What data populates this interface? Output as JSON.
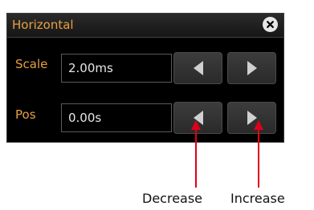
{
  "dialog": {
    "title": "Horizontal",
    "close_icon": "close-icon"
  },
  "rows": [
    {
      "label": "Scale",
      "value": "2.00ms"
    },
    {
      "label": "Pos",
      "value": "0.00s"
    }
  ],
  "buttons": {
    "decrease_icon": "triangle-left-icon",
    "increase_icon": "triangle-right-icon"
  },
  "annotations": {
    "decrease": "Decrease",
    "increase": "Increase"
  },
  "colors": {
    "label": "#e8a040",
    "arrow": "#e0001a",
    "panel": "#000000",
    "button": "#333333"
  }
}
